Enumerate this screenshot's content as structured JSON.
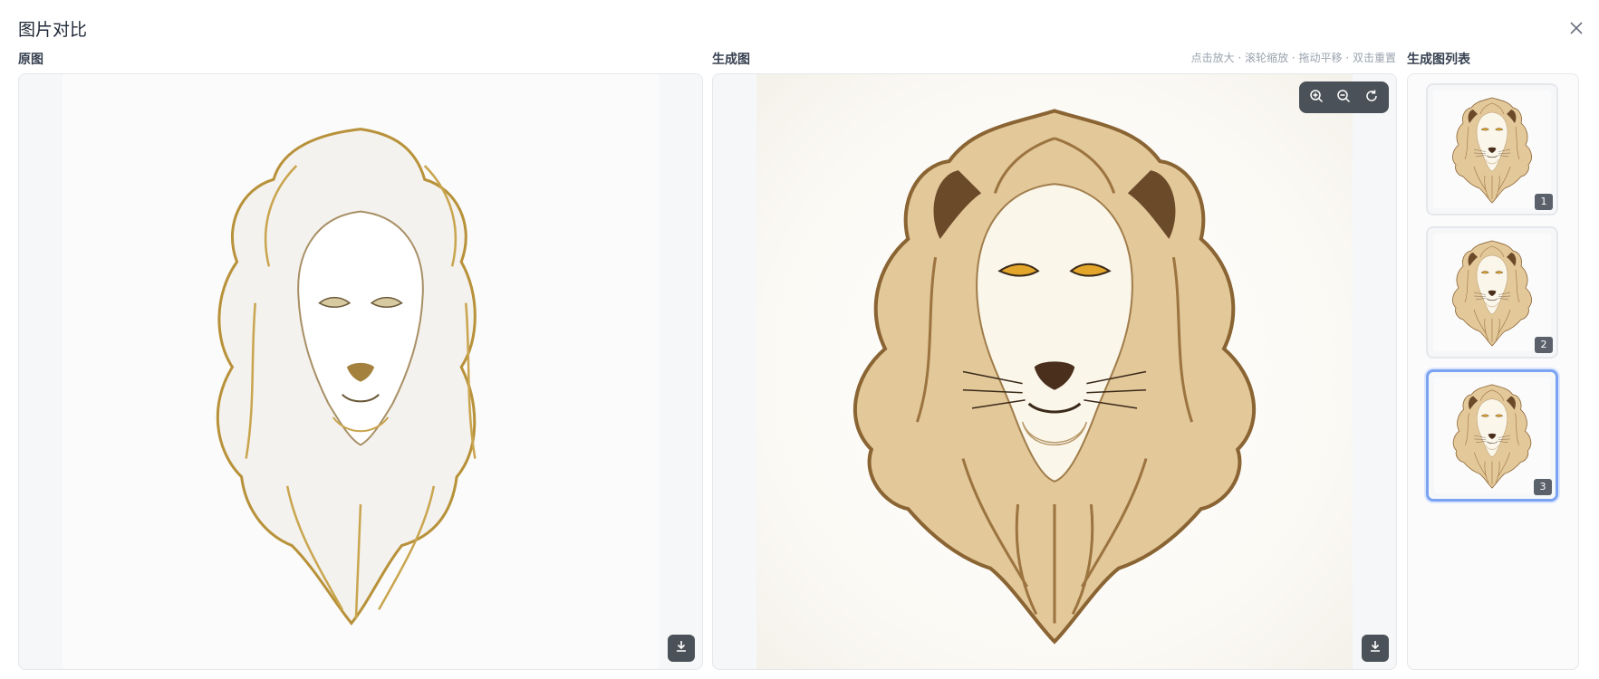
{
  "dialog": {
    "title": "图片对比",
    "close_icon": "close-icon"
  },
  "original_panel": {
    "label": "原图",
    "download_icon": "download-icon"
  },
  "generated_panel": {
    "label": "生成图",
    "hint": "点击放大 · 滚轮缩放 · 拖动平移 · 双击重置",
    "controls": {
      "zoom_in_icon": "zoom-in-icon",
      "zoom_out_icon": "zoom-out-icon",
      "reset_icon": "reset-icon"
    },
    "download_icon": "download-icon"
  },
  "list_panel": {
    "label": "生成图列表",
    "items": [
      {
        "badge": "1",
        "selected": false
      },
      {
        "badge": "2",
        "selected": false
      },
      {
        "badge": "3",
        "selected": true
      }
    ]
  },
  "colors": {
    "accent": "#7aa3f2",
    "toolbar": "#4b5158",
    "gold": "#b8923a",
    "brown": "#6b4a2a"
  }
}
